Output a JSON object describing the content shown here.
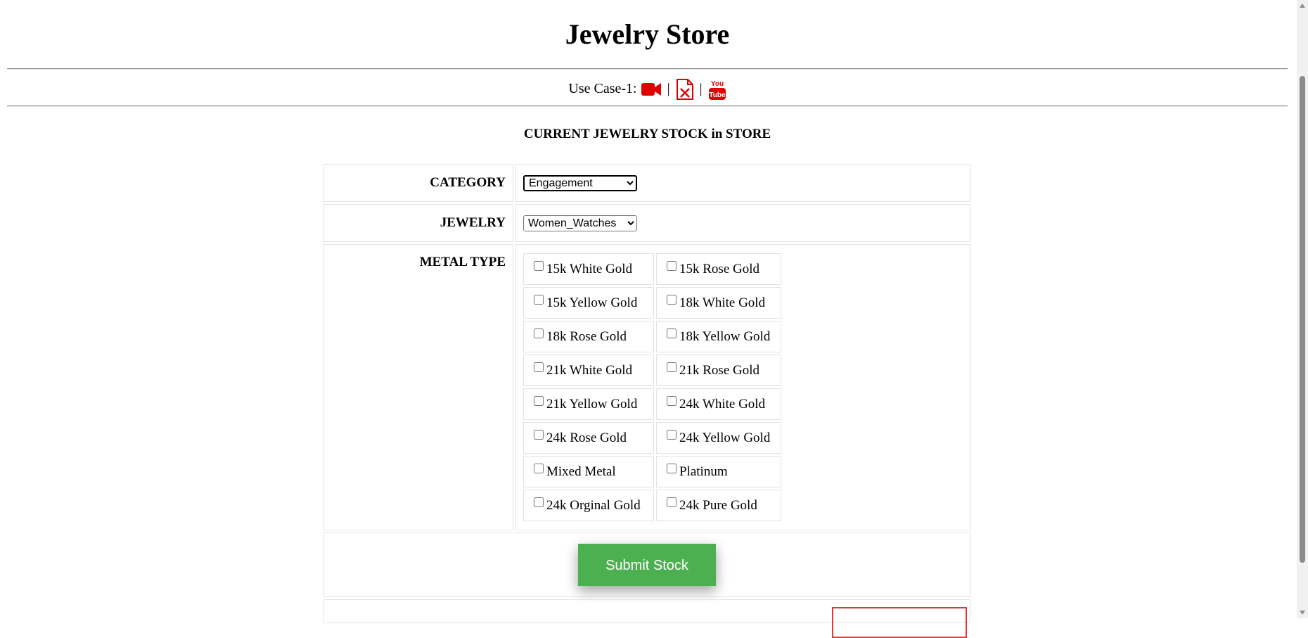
{
  "header": {
    "title": "Jewelry Store"
  },
  "use_case": {
    "label": "Use Case-1:",
    "separator": "|",
    "icons": [
      "video-camera-icon",
      "pdf-file-icon",
      "youtube-icon"
    ]
  },
  "section_heading": "CURRENT JEWELRY STOCK in STORE",
  "form": {
    "category": {
      "label": "CATEGORY",
      "selected": "Engagement"
    },
    "jewelry": {
      "label": "JEWELRY",
      "selected": "Women_Watches"
    },
    "metal_type": {
      "label": "METAL TYPE",
      "options": [
        [
          "15k White Gold",
          "15k Rose Gold"
        ],
        [
          "15k Yellow Gold",
          "18k White Gold"
        ],
        [
          "18k Rose Gold",
          "18k Yellow Gold"
        ],
        [
          "21k White Gold",
          "21k Rose Gold"
        ],
        [
          "21k Yellow Gold",
          "24k White Gold"
        ],
        [
          "24k Rose Gold",
          "24k Yellow Gold"
        ],
        [
          "Mixed Metal",
          "Platinum"
        ],
        [
          "24k Orginal Gold",
          "24k Pure Gold"
        ]
      ]
    },
    "submit_label": "Submit Stock"
  },
  "colors": {
    "submit_bg": "#4caf50",
    "icon_red": "#e00000",
    "border": "#e2e2e2"
  }
}
